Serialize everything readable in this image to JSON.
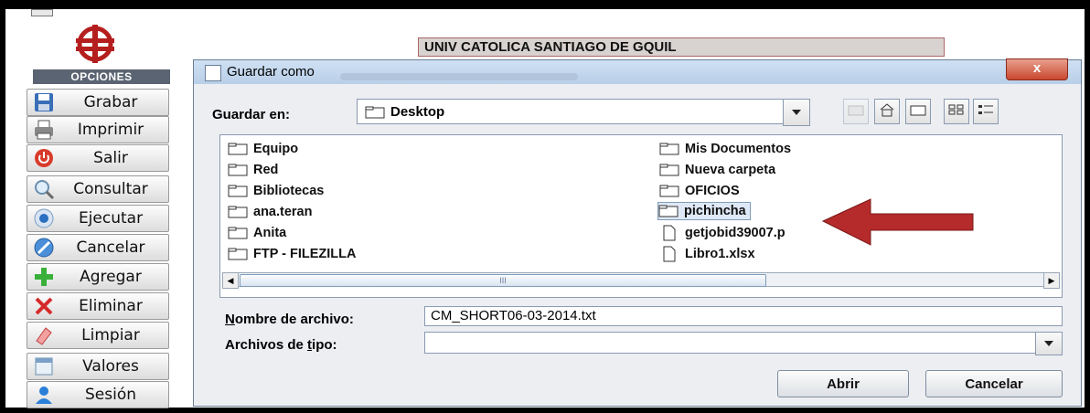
{
  "header": {
    "university": "UNIV CATOLICA SANTIAGO DE GQUIL"
  },
  "sidebar": {
    "title": "OPCIONES",
    "items": [
      {
        "label": "Grabar",
        "icon": "floppy-disk-icon"
      },
      {
        "label": "Imprimir",
        "icon": "printer-icon"
      },
      {
        "label": "Salir",
        "icon": "power-icon"
      },
      {
        "label": "Consultar",
        "icon": "magnifier-icon"
      },
      {
        "label": "Ejecutar",
        "icon": "execute-icon"
      },
      {
        "label": "Cancelar",
        "icon": "cancel-icon"
      },
      {
        "label": "Agregar",
        "icon": "plus-icon"
      },
      {
        "label": "Eliminar",
        "icon": "x-icon"
      },
      {
        "label": "Limpiar",
        "icon": "eraser-icon"
      },
      {
        "label": "Valores",
        "icon": "values-icon"
      },
      {
        "label": "Sesión",
        "icon": "user-icon"
      }
    ]
  },
  "dialog": {
    "title": "Guardar como",
    "close": "x",
    "look_in_label": "Guardar en:",
    "look_in_value": "Desktop",
    "files_left": [
      "Equipo",
      "Red",
      "Bibliotecas",
      "ana.teran",
      "Anita",
      "FTP - FILEZILLA"
    ],
    "files_right": [
      {
        "name": "Mis Documentos",
        "type": "folder"
      },
      {
        "name": "Nueva carpeta",
        "type": "folder"
      },
      {
        "name": "OFICIOS",
        "type": "folder"
      },
      {
        "name": "pichincha",
        "type": "folder",
        "selected": true
      },
      {
        "name": "getjobid39007.p",
        "type": "file"
      },
      {
        "name": "Libro1.xlsx",
        "type": "file"
      }
    ],
    "scroll_thumb": "III",
    "filename_label_first": "N",
    "filename_label_rest": "ombre de archivo:",
    "filename_value": "CM_SHORT06-03-2014.txt",
    "filetype_label_a": "Archivos de ",
    "filetype_label_u": "t",
    "filetype_label_b": "ipo:",
    "filetype_value": "",
    "open_button": "Abrir",
    "cancel_button": "Cancelar"
  },
  "colors": {
    "arrow": "#b52a2a",
    "emblem": "#b51e1e",
    "selection": "#dfe8f6"
  }
}
